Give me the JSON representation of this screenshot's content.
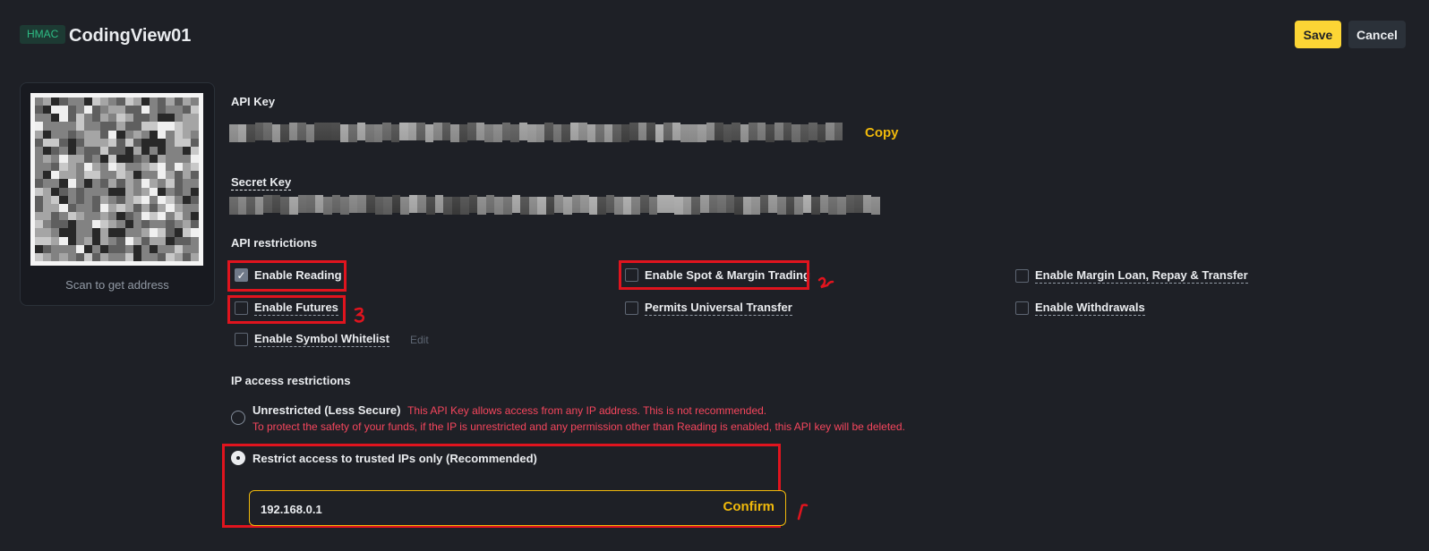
{
  "header": {
    "badge": "HMAC",
    "title": "CodingView01",
    "save_label": "Save",
    "cancel_label": "Cancel"
  },
  "qr": {
    "caption": "Scan to get address"
  },
  "api_key": {
    "label": "API Key",
    "copy_label": "Copy"
  },
  "secret_key": {
    "label": "Secret Key"
  },
  "restrictions": {
    "title": "API restrictions",
    "options": [
      {
        "id": "reading",
        "label": "Enable Reading",
        "checked": true
      },
      {
        "id": "spot",
        "label": "Enable Spot & Margin Trading",
        "checked": false
      },
      {
        "id": "margin-loan",
        "label": "Enable Margin Loan, Repay & Transfer",
        "checked": false
      },
      {
        "id": "futures",
        "label": "Enable Futures",
        "checked": false
      },
      {
        "id": "universal",
        "label": "Permits Universal Transfer",
        "checked": false
      },
      {
        "id": "withdrawals",
        "label": "Enable Withdrawals",
        "checked": false
      },
      {
        "id": "whitelist",
        "label": "Enable Symbol Whitelist",
        "checked": false
      }
    ],
    "edit_label": "Edit"
  },
  "ip": {
    "title": "IP access restrictions",
    "unrestricted_label": "Unrestricted (Less Secure)",
    "unrestricted_warning": "This API Key allows access from any IP address. This is not recommended.",
    "unrestricted_warning_2": "To protect the safety of your funds, if the IP is unrestricted and any permission other than Reading is enabled, this API key will be deleted.",
    "restricted_label": "Restrict access to trusted IPs only (Recommended)",
    "input_value": "192.168.0.1",
    "confirm_label": "Confirm",
    "selected": "restricted"
  },
  "colors": {
    "accent": "#f0b90b",
    "save_bg": "#fcd535",
    "warning": "#f6465d",
    "annotation": "#e0141e",
    "badge_text": "#2ebd85"
  }
}
